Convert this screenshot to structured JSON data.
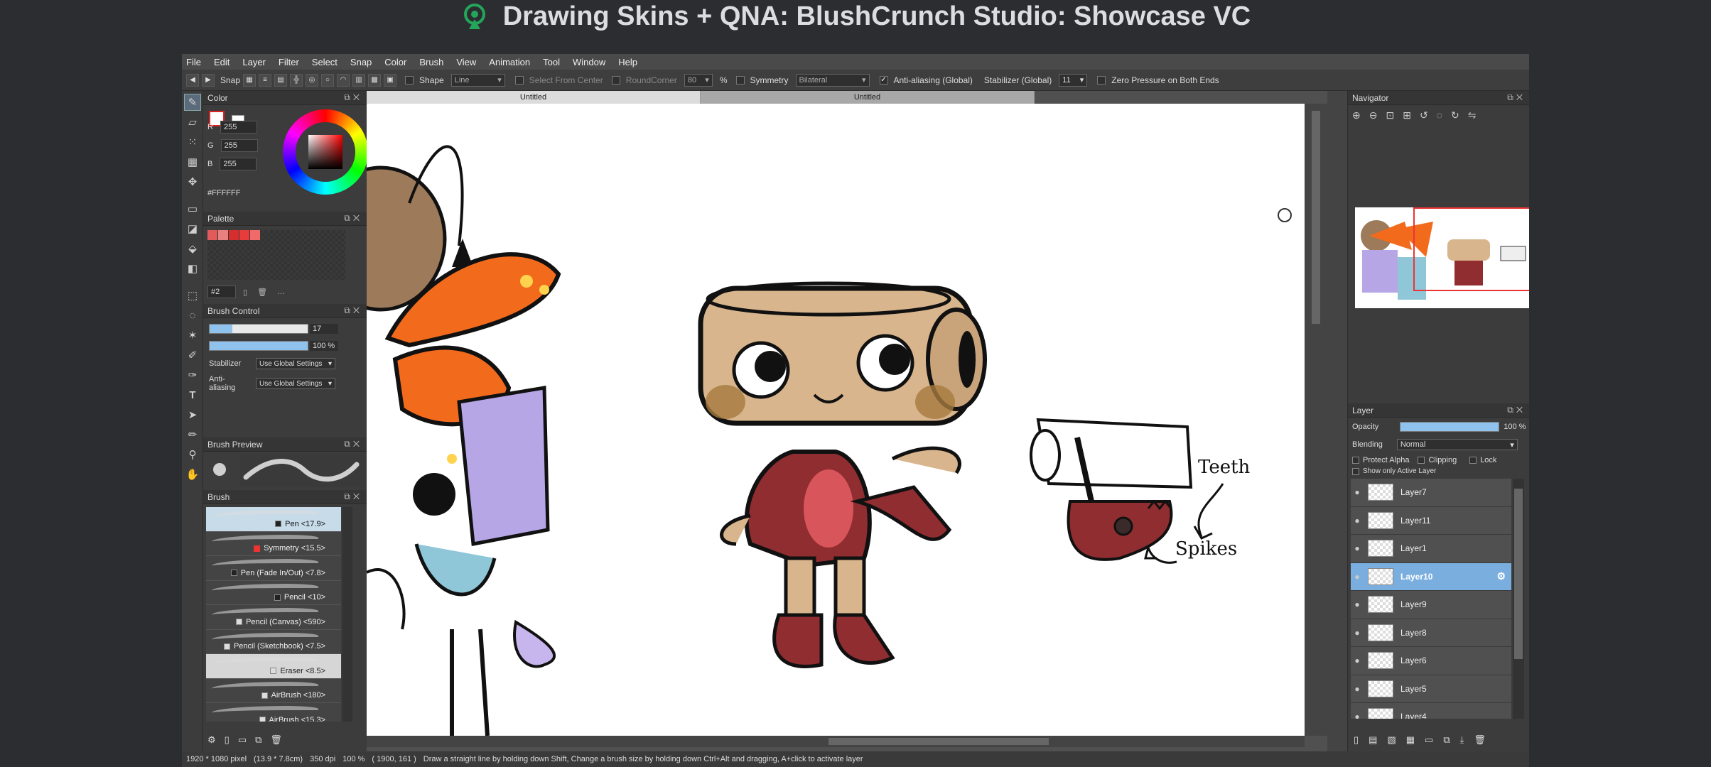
{
  "stage": {
    "title": "Drawing Skins + QNA: BlushCrunch Studio: Showcase VC",
    "accent": "#23a55a"
  },
  "menu": [
    "File",
    "Edit",
    "Layer",
    "Filter",
    "Select",
    "Snap",
    "Color",
    "Brush",
    "View",
    "Animation",
    "Tool",
    "Window",
    "Help"
  ],
  "toolbar": {
    "snap_label": "Snap",
    "shape_label": "Shape",
    "shape_value": "Line",
    "select_from_center": "Select From Center",
    "round_corner": "RoundCorner",
    "round_corner_value": "80",
    "percent": "%",
    "symmetry_label": "Symmetry",
    "symmetry_value": "Bilateral",
    "antialias_label": "Anti-aliasing (Global)",
    "stabilizer_label": "Stabilizer (Global)",
    "stabilizer_value": "11",
    "zero_pressure": "Zero Pressure on Both Ends"
  },
  "color_panel": {
    "title": "Color",
    "r_label": "R",
    "r": "255",
    "g_label": "G",
    "g": "255",
    "b_label": "B",
    "b": "255",
    "hex": "#FFFFFF",
    "swatch_border": "#dd2222"
  },
  "palette_panel": {
    "title": "Palette",
    "colors": [
      "#e25a5a",
      "#e98080",
      "#d62e2e",
      "#e83c3c",
      "#f06a6a"
    ],
    "selector": "#2"
  },
  "brush_control": {
    "title": "Brush Control",
    "size": "17",
    "size_fraction": 0.23,
    "opacity": "100 %",
    "opacity_fraction": 1.0,
    "stabilizer_label": "Stabilizer",
    "stabilizer_value": "Use Global Settings",
    "antialias_label": "Anti-aliasing",
    "antialias_value": "Use Global Settings"
  },
  "brush_preview": {
    "title": "Brush Preview"
  },
  "brush_panel": {
    "title": "Brush",
    "items": [
      {
        "label": "Pen <17.9>",
        "state": "selected",
        "check": "dark"
      },
      {
        "label": "Symmetry <15.5>",
        "state": "",
        "check": "red"
      },
      {
        "label": "Pen (Fade In/Out) <7.8>",
        "state": "",
        "check": "dark"
      },
      {
        "label": "Pencil <10>",
        "state": "",
        "check": "dark"
      },
      {
        "label": "Pencil (Canvas) <590>",
        "state": "",
        "check": "light"
      },
      {
        "label": "Pencil (Sketchbook) <7.5>",
        "state": "",
        "check": "light"
      },
      {
        "label": "Eraser <8.5>",
        "state": "selected2",
        "check": "light"
      },
      {
        "label": "AirBrush <180>",
        "state": "",
        "check": "light"
      },
      {
        "label": "AirBrush <15.3>",
        "state": "",
        "check": "light"
      }
    ]
  },
  "tabs": [
    "Untitled",
    "Untitled"
  ],
  "canvas_labels": {
    "teeth": "Teeth",
    "spikes": "Spikes"
  },
  "navigator": {
    "title": "Navigator"
  },
  "layer_panel": {
    "title": "Layer",
    "opacity_label": "Opacity",
    "opacity_value": "100 %",
    "blending_label": "Blending",
    "blending_value": "Normal",
    "protect_alpha": "Protect Alpha",
    "clipping": "Clipping",
    "lock": "Lock",
    "show_only_active": "Show only Active Layer",
    "layers": [
      {
        "name": "Layer7",
        "active": false
      },
      {
        "name": "Layer11",
        "active": false
      },
      {
        "name": "Layer1",
        "active": false
      },
      {
        "name": "Layer10",
        "active": true
      },
      {
        "name": "Layer9",
        "active": false
      },
      {
        "name": "Layer8",
        "active": false
      },
      {
        "name": "Layer6",
        "active": false
      },
      {
        "name": "Layer5",
        "active": false
      },
      {
        "name": "Layer4",
        "active": false
      }
    ]
  },
  "status": {
    "size": "1920 * 1080 pixel",
    "cm": "(13.9 * 7.8cm)",
    "dpi": "350 dpi",
    "zoom": "100 %",
    "coords": "( 1900, 161 )",
    "hint": "Draw a straight line by holding down Shift, Change a brush size by holding down Ctrl+Alt and dragging, A+click to activate layer"
  }
}
